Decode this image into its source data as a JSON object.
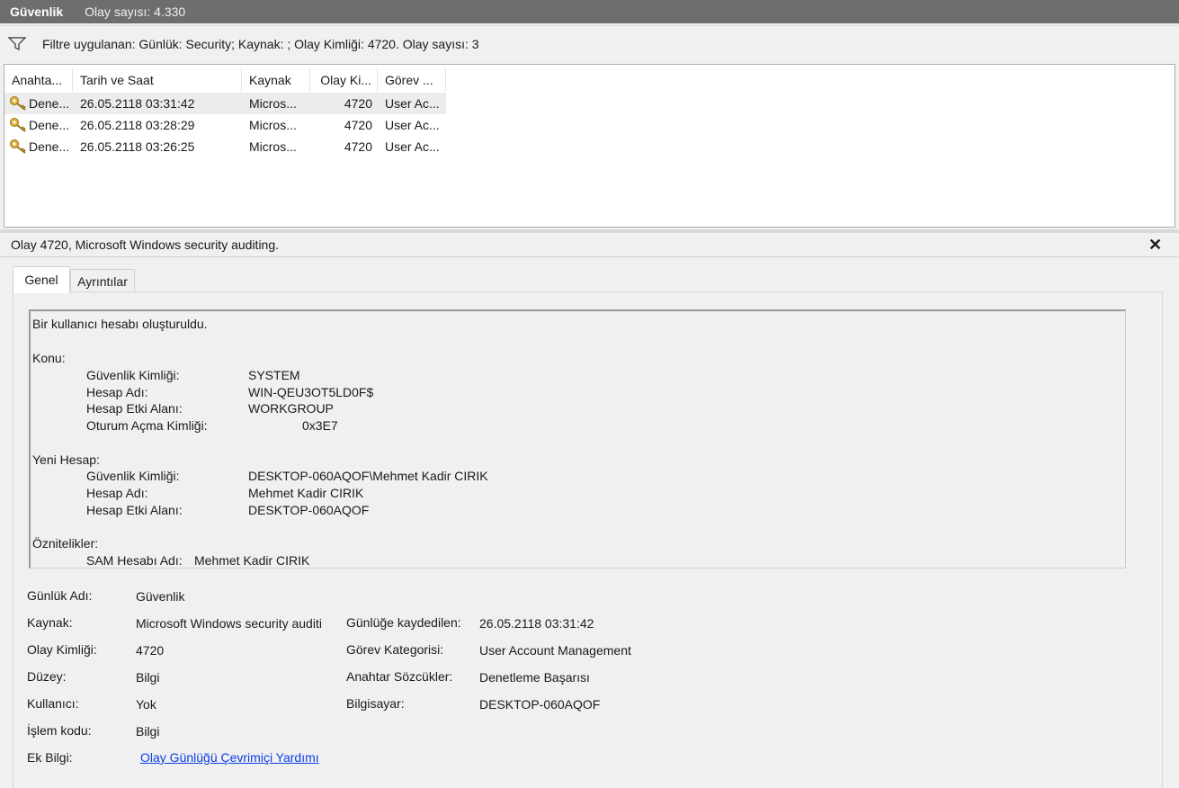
{
  "titlebar": {
    "log_name": "Güvenlik",
    "event_count": "Olay sayısı: 4.330"
  },
  "filter": {
    "icon": "funnel-icon",
    "text": "Filtre uygulanan: Günlük: Security; Kaynak: ; Olay Kimliği: 4720. Olay sayısı: 3"
  },
  "list": {
    "columns": [
      "Anahta...",
      "Tarih ve Saat",
      "Kaynak",
      "Olay Ki...",
      "Görev ..."
    ],
    "rows": [
      {
        "keyword": "Dene...",
        "datetime": "26.05.2118 03:31:42",
        "source": "Micros...",
        "event_id": "4720",
        "task": "User Ac..."
      },
      {
        "keyword": "Dene...",
        "datetime": "26.05.2118 03:28:29",
        "source": "Micros...",
        "event_id": "4720",
        "task": "User Ac..."
      },
      {
        "keyword": "Dene...",
        "datetime": "26.05.2118 03:26:25",
        "source": "Micros...",
        "event_id": "4720",
        "task": "User Ac..."
      }
    ]
  },
  "detail": {
    "title": "Olay 4720, Microsoft Windows security auditing.",
    "close": "✕",
    "tabs": [
      "Genel",
      "Ayrıntılar"
    ],
    "message": {
      "line0": "Bir kullanıcı hesabı oluşturuldu.",
      "subject_heading": "Konu:",
      "subject": [
        {
          "label": "Güvenlik Kimliği:",
          "value": "SYSTEM"
        },
        {
          "label": "Hesap Adı:",
          "value": "WIN-QEU3OT5LD0F$"
        },
        {
          "label": "Hesap Etki Alanı:",
          "value": "WORKGROUP"
        },
        {
          "label": "Oturum Açma Kimliği:",
          "value": "0x3E7"
        }
      ],
      "new_heading": "Yeni Hesap:",
      "new_account": [
        {
          "label": "Güvenlik Kimliği:",
          "value": "DESKTOP-060AQOF\\Mehmet Kadir CIRIK"
        },
        {
          "label": "Hesap Adı:",
          "value": "Mehmet Kadir CIRIK"
        },
        {
          "label": "Hesap Etki Alanı:",
          "value": "DESKTOP-060AQOF"
        }
      ],
      "attr_heading": "Öznitelikler:",
      "sam": {
        "label": "SAM Hesabı Adı:",
        "value": "Mehmet Kadir CIRIK"
      }
    },
    "props": {
      "log_name_label": "Günlük Adı:",
      "log_name": "Güvenlik",
      "source_label": "Kaynak:",
      "source": "Microsoft Windows security auditi",
      "logged_label": "Günlüğe kaydedilen:",
      "logged": "26.05.2118 03:31:42",
      "event_id_label": "Olay Kimliği:",
      "event_id": "4720",
      "task_label": "Görev Kategorisi:",
      "task": "User Account Management",
      "level_label": "Düzey:",
      "level": "Bilgi",
      "keywords_label": "Anahtar Sözcükler:",
      "keywords": "Denetleme Başarısı",
      "user_label": "Kullanıcı:",
      "user": "Yok",
      "computer_label": "Bilgisayar:",
      "computer": "DESKTOP-060AQOF",
      "opcode_label": "İşlem kodu:",
      "opcode": "Bilgi",
      "more_label": "Ek Bilgi:",
      "more_link": "Olay Günlüğü Çevrimiçi Yardımı"
    }
  }
}
